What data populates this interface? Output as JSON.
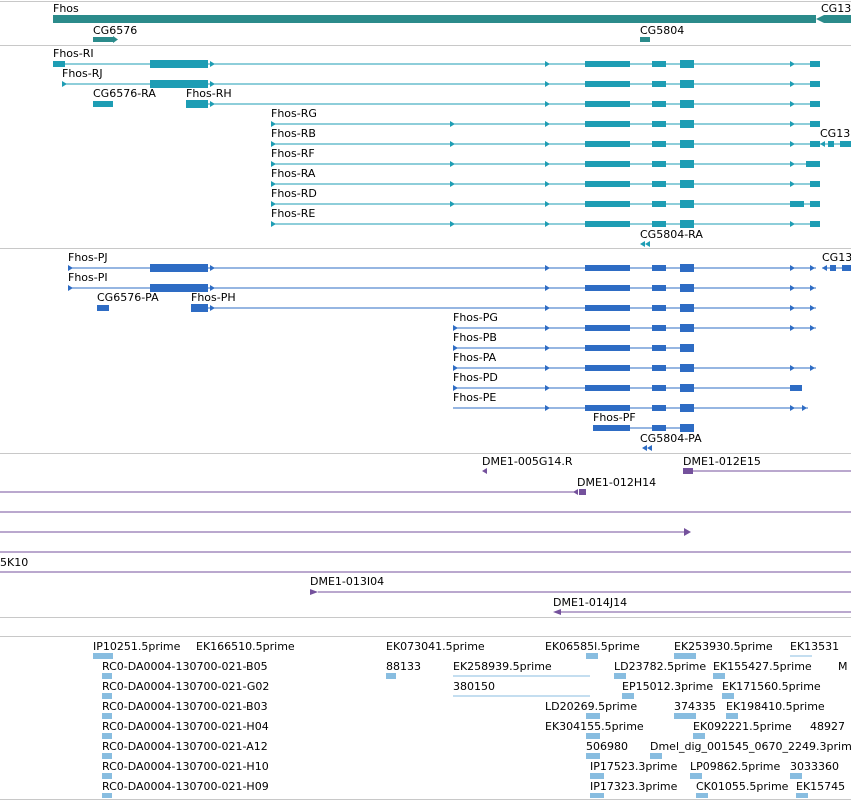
{
  "colors": {
    "gene": "#2b8b8b",
    "tx_ri": "#1e9db4",
    "tx_pi": "#2e6cc4",
    "clone": "#74519c",
    "est": "#88bde0",
    "divider": "#c8c8c8"
  },
  "gene_track": {
    "genes": [
      {
        "name": "Fhos"
      },
      {
        "name": "CG13"
      },
      {
        "name": "CG6576"
      },
      {
        "name": "CG5804"
      }
    ]
  },
  "transcript_track": {
    "transcripts": [
      {
        "name": "Fhos-RI"
      },
      {
        "name": "Fhos-RJ"
      },
      {
        "name": "CG6576-RA"
      },
      {
        "name": "Fhos-RH"
      },
      {
        "name": "Fhos-RG"
      },
      {
        "name": "Fhos-RB"
      },
      {
        "name": "CG13"
      },
      {
        "name": "Fhos-RF"
      },
      {
        "name": "Fhos-RA"
      },
      {
        "name": "Fhos-RD"
      },
      {
        "name": "Fhos-RE"
      },
      {
        "name": "CG5804-RA"
      }
    ]
  },
  "protein_track": {
    "proteins": [
      {
        "name": "Fhos-PJ"
      },
      {
        "name": "CG13"
      },
      {
        "name": "Fhos-PI"
      },
      {
        "name": "CG6576-PA"
      },
      {
        "name": "Fhos-PH"
      },
      {
        "name": "Fhos-PG"
      },
      {
        "name": "Fhos-PB"
      },
      {
        "name": "Fhos-PA"
      },
      {
        "name": "Fhos-PD"
      },
      {
        "name": "Fhos-PE"
      },
      {
        "name": "Fhos-PF"
      },
      {
        "name": "CG5804-PA"
      }
    ]
  },
  "clone_track": {
    "clones": [
      {
        "name": "DME1-005G14.R"
      },
      {
        "name": "DME1-012E15"
      },
      {
        "name": "DME1-012H14"
      },
      {
        "name": "5K10"
      },
      {
        "name": "DME1-013I04"
      },
      {
        "name": "DME1-014J14"
      }
    ]
  },
  "est_track": {
    "ests": [
      {
        "name": "IP10251.5prime"
      },
      {
        "name": "EK166510.5prime"
      },
      {
        "name": "EK073041.5prime"
      },
      {
        "name": "EK06585l.5prime"
      },
      {
        "name": "EK253930.5prime"
      },
      {
        "name": "EK13531"
      },
      {
        "name": "RC0-DA0004-130700-021-B05"
      },
      {
        "name": "88133"
      },
      {
        "name": "EK258939.5prime"
      },
      {
        "name": "LD23782.5prime"
      },
      {
        "name": "EK155427.5prime"
      },
      {
        "name": "M"
      },
      {
        "name": "RC0-DA0004-130700-021-G02"
      },
      {
        "name": "380150"
      },
      {
        "name": "EP15012.3prime"
      },
      {
        "name": "EK171560.5prime"
      },
      {
        "name": "RC0-DA0004-130700-021-B03"
      },
      {
        "name": "LD20269.5prime"
      },
      {
        "name": "374335"
      },
      {
        "name": "EK198410.5prime"
      },
      {
        "name": "RC0-DA0004-130700-021-H04"
      },
      {
        "name": "EK304155.5prime"
      },
      {
        "name": "EK092221.5prime"
      },
      {
        "name": "48927"
      },
      {
        "name": "RC0-DA0004-130700-021-A12"
      },
      {
        "name": "506980"
      },
      {
        "name": "Dmel_dig_001545_0670_2249.3prime"
      },
      {
        "name": "RC0-DA0004-130700-021-H10"
      },
      {
        "name": "IP17523.3prime"
      },
      {
        "name": "LP09862.5prime"
      },
      {
        "name": "3033360"
      },
      {
        "name": "RC0-DA0004-130700-021-H09"
      },
      {
        "name": "IP17323.3prime"
      },
      {
        "name": "CK01055.5prime"
      },
      {
        "name": "EK15745"
      }
    ]
  }
}
